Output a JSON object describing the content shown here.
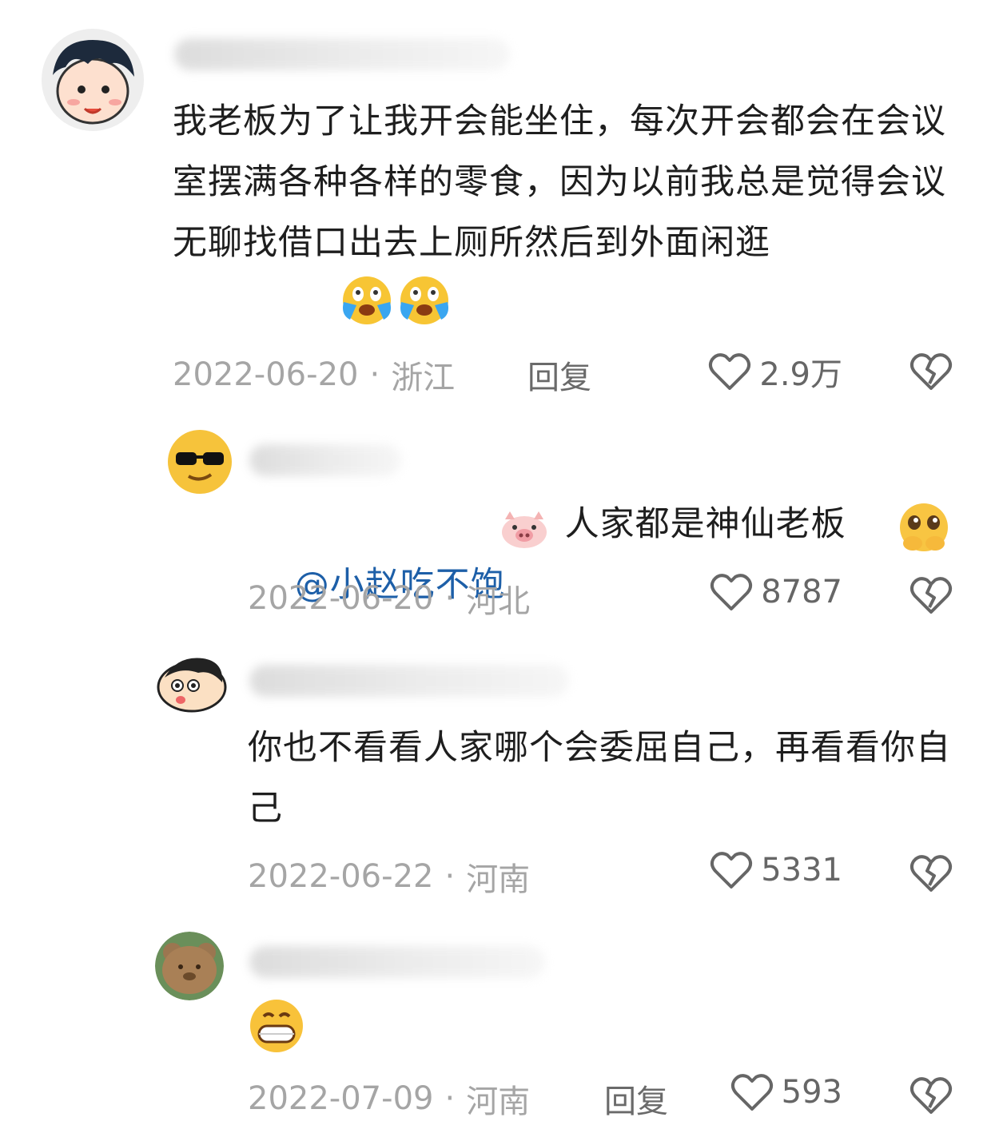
{
  "comments": [
    {
      "text": "我老板为了让我开会能坐住，每次开会都会在会议室摆满各种各样的零食，因为以前我总是觉得会议无聊找借口出去上厕所然后到外面闲逛",
      "date": "2022-06-20",
      "location": "浙江",
      "reply_label": "回复",
      "likes": "2.9万"
    },
    {
      "mention": "@小赵吃不饱",
      "text": " 人家都是神仙老板",
      "date": "2022-06-20",
      "location": "河北",
      "likes": "8787"
    },
    {
      "text": "你也不看看人家哪个会委屈自己，再看看你自己",
      "date": "2022-06-22",
      "location": "河南",
      "likes": "5331"
    },
    {
      "date": "2022-07-09",
      "location": "河南",
      "reply_label": "回复",
      "likes": "593"
    }
  ],
  "icons": {
    "like": "heart-outline-icon",
    "dislike": "broken-heart-icon"
  },
  "colors": {
    "mention": "#1d5fa8",
    "meta": "#a5a5a5",
    "text": "#1e1e1e"
  }
}
